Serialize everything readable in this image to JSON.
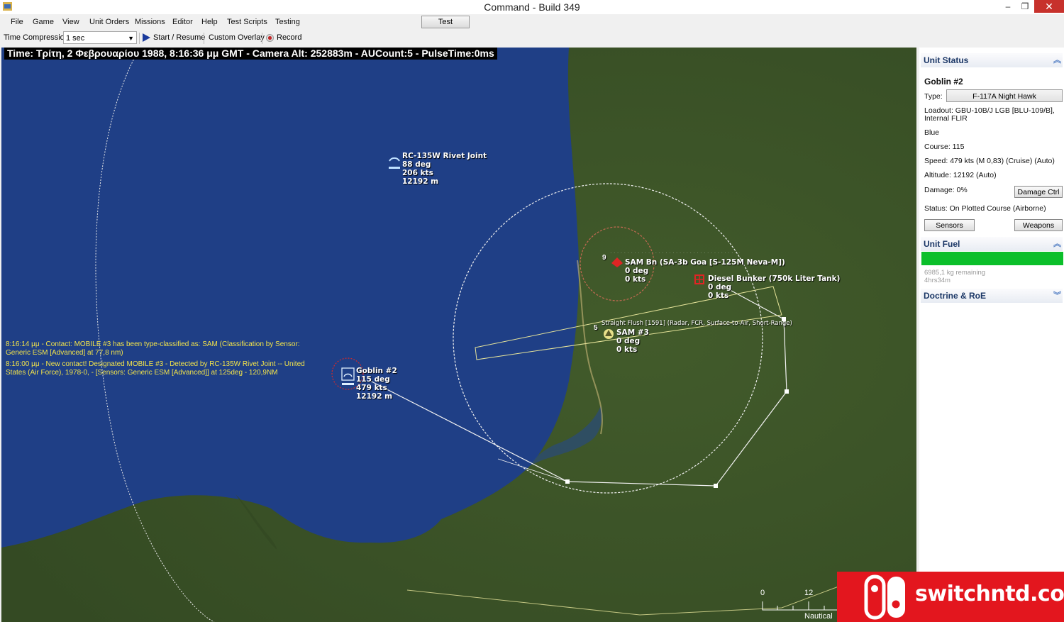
{
  "window": {
    "title": "Command - Build 349"
  },
  "menu": [
    "File",
    "Game",
    "View",
    "Unit Orders",
    "Missions",
    "Editor",
    "Help",
    "Test Scripts",
    "Testing"
  ],
  "test_button": "Test",
  "toolbar": {
    "time_compression_label": "Time Compression:",
    "time_compression_value": "1 sec",
    "start_resume": "Start / Resume",
    "custom_overlay": "Custom Overlay",
    "record": "Record"
  },
  "map": {
    "status_bar": "Time: Τρίτη, 2 Φεβρουαρίου 1988, 8:16:36 μμ GMT - Camera Alt: 252883m - AUCount:5 - PulseTime:0ms",
    "messages": [
      "8:16:14 μμ - Contact: MOBILE #3 has been type-classified as: SAM (Classification by Sensor: Generic ESM [Advanced] at 77,8 nm)",
      "8:16:00 μμ - New contact! Designated MOBILE #3 - Detected by RC-135W Rivet Joint -- United States (Air Force), 1978-0, - [Sensors: Generic ESM [Advanced]] at 125deg - 120,9NM"
    ],
    "units": {
      "rc135": [
        "RC-135W Rivet Joint",
        "88 deg",
        "206 kts",
        "12192 m"
      ],
      "goblin": [
        "Goblin #2",
        "115 deg",
        "479 kts",
        "12192 m"
      ],
      "sam_bn": [
        "SAM Bn (SA-3b Goa [S-125M Neva-M])",
        "0 deg",
        "0 kts"
      ],
      "bunker": [
        "Diesel Bunker (750k Liter Tank)",
        "0 deg",
        "0 kts"
      ],
      "sam3": [
        "SAM #3",
        "0 deg",
        "0 kts"
      ]
    },
    "sensor_note": "Straight Flush [1591] (Radar, FCR, Surface-to-Air, Short-Range)",
    "marker_numbers": [
      "9",
      "5"
    ],
    "scale": {
      "start": "0",
      "end": "12",
      "unit": "Nautical"
    }
  },
  "panel": {
    "unit_status_header": "Unit Status",
    "unit_name": "Goblin #2",
    "type_label": "Type:",
    "type_value": "F-117A Night Hawk",
    "loadout": "Loadout: GBU-10B/J LGB [BLU-109/B],",
    "loadout2": "Internal FLIR",
    "side": "Blue",
    "course": "Course: 115",
    "speed": "Speed: 479 kts (M 0,83) (Cruise)     (Auto)",
    "altitude": "Altitude: 12192     (Auto)",
    "damage": "Damage: 0%",
    "damage_ctrl_button": "Damage Ctrl",
    "status": "Status: On Plotted Course (Airborne)",
    "sensors_button": "Sensors",
    "weapons_button": "Weapons",
    "unit_fuel_header": "Unit Fuel",
    "fuel_fraction": 1.0,
    "fuel_remaining": "6985,1 kg remaining",
    "fuel_time": "4hrs34m",
    "doctrine_header": "Doctrine & RoE"
  },
  "watermark": {
    "text": "switchntd.com"
  },
  "colors": {
    "sea": "#1f3f86",
    "land": "#3c5427",
    "fuel": "#0bbf2a",
    "accent_close": "#c7312c",
    "message": "#f2e34a"
  }
}
